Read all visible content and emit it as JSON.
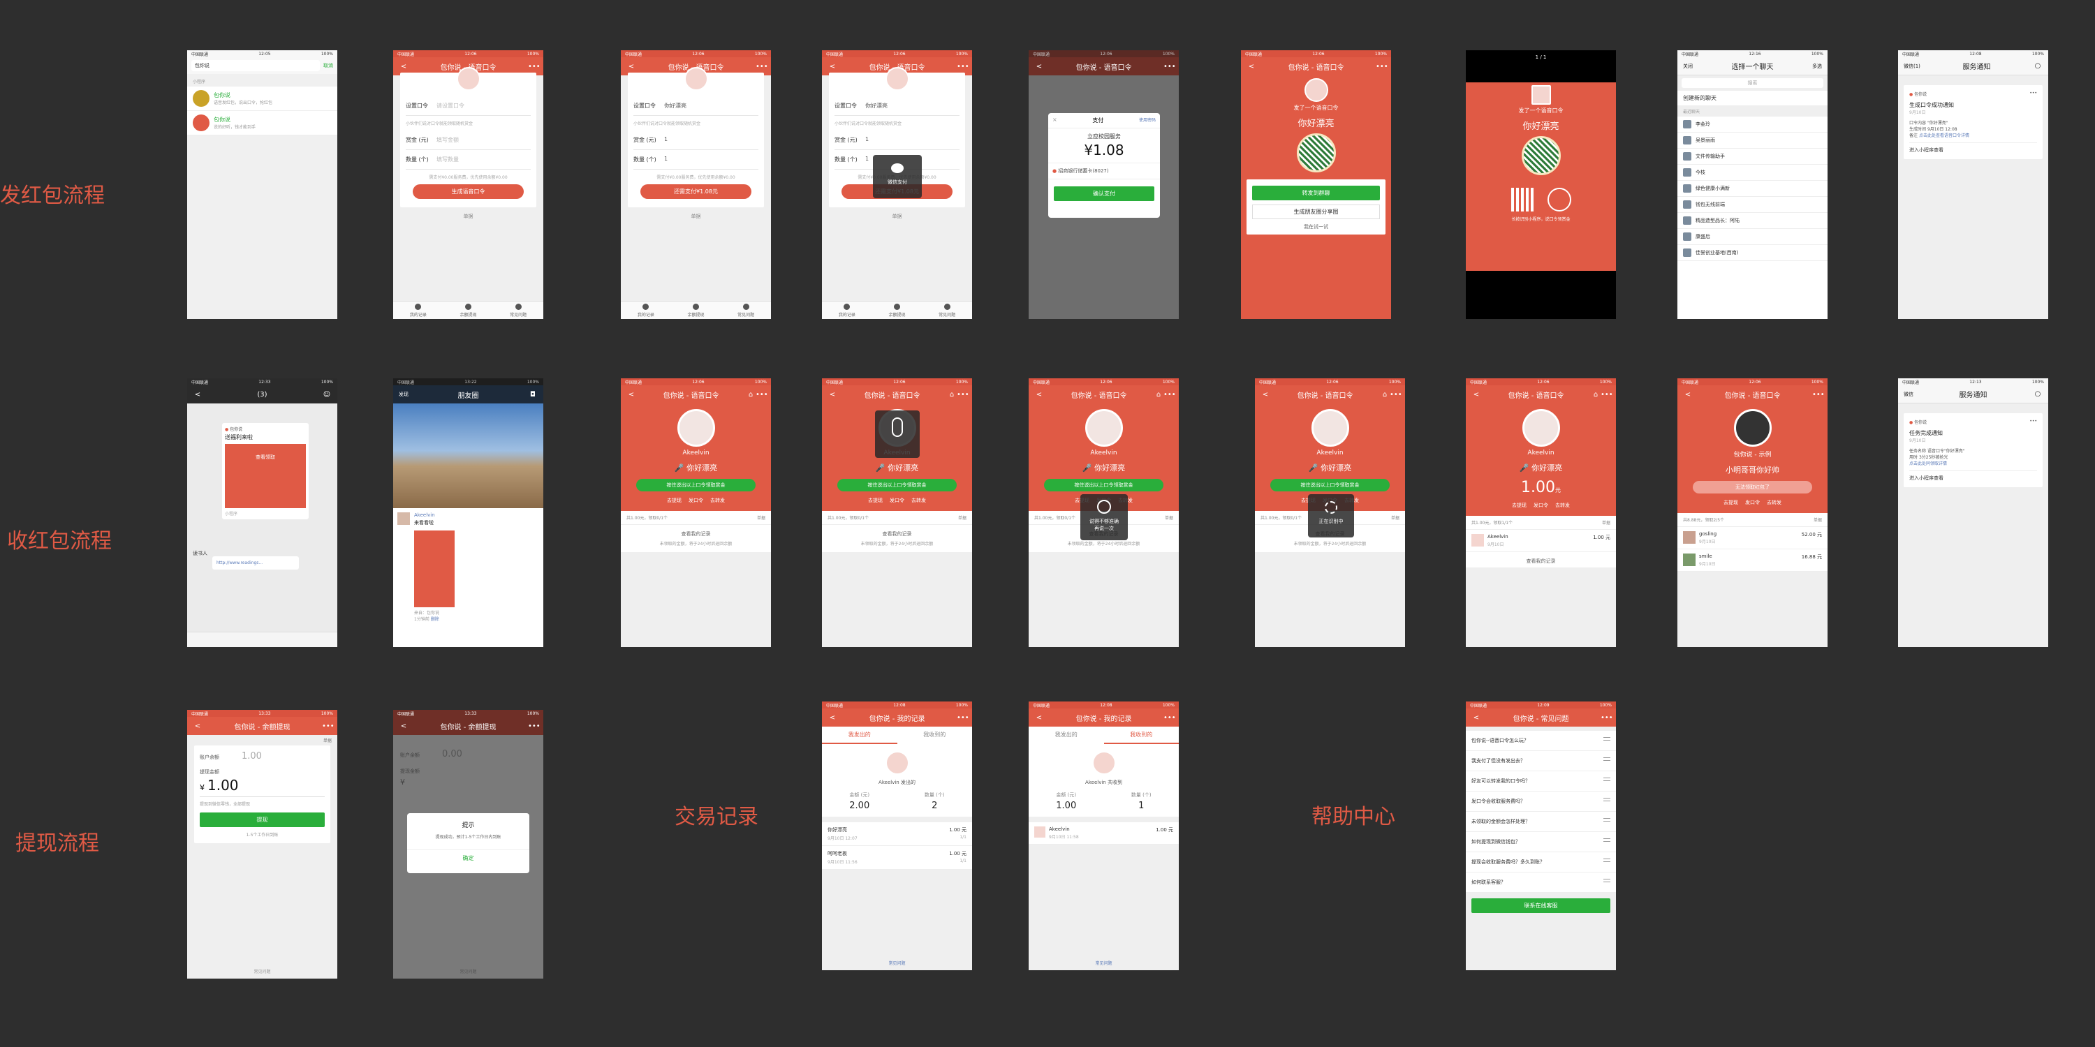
{
  "sections": {
    "send": "发红包流程",
    "receive": "收红包流程",
    "withdraw": "提现流程",
    "records": "交易记录",
    "help": "帮助中心"
  },
  "common": {
    "carrier": "中国联通",
    "battery": "100%",
    "app_title": "包你说 - 语音口令",
    "back": "<",
    "more": "•••",
    "single_list": "单据",
    "tabs": [
      "我的记录",
      "余额提现",
      "常见问题"
    ],
    "nickname": "Akeelvin",
    "voice_word": "你好漂亮",
    "hold_button": "按住说出以上口令领取赏金",
    "actions": [
      "去提现",
      "发口令",
      "去转发"
    ],
    "view_records": "查看我的记录",
    "unclaimed_note": "未领取的金额，将于24小时后退回余额",
    "summary": "共1.00元，领取0/1个",
    "help_link": "常见问题"
  },
  "send": {
    "search": {
      "time": "12:05",
      "query": "包你说",
      "cancel": "取消",
      "section": "小程序",
      "item1_title": "包你说",
      "item1_desc": "语音发红包，说出口令，抢红包",
      "item2_title": "包你说",
      "item2_desc": "说的好听，钱才能到手"
    },
    "form": {
      "time": "12:06",
      "word_label": "设置口令",
      "word_placeholder": "请设置口令",
      "word_value": "你好漂亮",
      "hint": "小伙伴们说对口令就能领取随机赏金",
      "amount_label": "赏金 (元)",
      "amount_placeholder": "填写金额",
      "amount_value": "1",
      "count_label": "数量 (个)",
      "count_placeholder": "填写数量",
      "count_value": "1",
      "fee_note": "需支付¥0.00服务费，优先使用余额¥0.00",
      "gen_button": "生成语音口令",
      "pay_button": "还需支付¥1.08元"
    },
    "wechat_pay_toast": "微信支付",
    "pay": {
      "title": "支付",
      "use_pwd": "使用密码",
      "merchant": "立应校园服务",
      "amount": "¥1.08",
      "bank": "招商银行储蓄卡(8027)",
      "confirm": "确认支付"
    },
    "share": {
      "sent": "发了一个语音口令",
      "word": "你好漂亮",
      "forward": "转发到群聊",
      "moments": "生成朋友圈分享图",
      "later": "我在试一试"
    },
    "poster": {
      "page": "1 / 1",
      "sent": "发了一个语音口令",
      "word": "你好漂亮",
      "scan": "长按识别小程序，说口令领赏金"
    },
    "chat": {
      "time": "12:16",
      "close": "关闭",
      "title": "选择一个聊天",
      "multi": "多选",
      "search": "搜索",
      "new_chat": "创建新的聊天",
      "recent": "最近聊天",
      "contacts": [
        "李金玲",
        "吴景丽雨",
        "文件传输助手",
        "今枝",
        "绿色健康小满新",
        "钱包无线前端",
        "精品造型品长：阿陆",
        "康盛后",
        "佳誉创业基地(西南)"
      ]
    },
    "notice": {
      "time": "12:08",
      "back": "微信(1)",
      "title": "服务通知",
      "app": "包你说",
      "notice_title": "生成口令成功通知",
      "date": "9月10日",
      "k1": "口令内容",
      "v1": "\"你好漂亮\"",
      "k2": "生成时间",
      "v2": "9月10日 12:08",
      "k3": "备注",
      "v3": "点击此处查看语音口令详情",
      "enter": "进入小程序查看"
    }
  },
  "receive": {
    "group": {
      "time": "12:33",
      "title": "(3)",
      "card_app": "包你说",
      "card_title": "送福利来啦",
      "card_btn": "查看领取",
      "card_foot": "小程序",
      "sender": "读书人",
      "link": "http://www.readings..."
    },
    "moments": {
      "time": "13:22",
      "back": "发现",
      "title": "朋友圈",
      "name": "Akeelvin",
      "post": "来看看啦",
      "source": "来自：包你说",
      "ago": "1分钟前",
      "del": "删除"
    },
    "recording_toast": "",
    "fail_toast": "再说一次",
    "fail_sub": "说得不够准确",
    "loading_toast": "正在识别中",
    "received": {
      "amount": "1.00",
      "unit": "元",
      "summary": "共1.00元，领取1/1个",
      "winner": "Akeelvin",
      "winner_amount": "1.00 元",
      "winner_time": "9月10日"
    },
    "other": {
      "nickname": "包你说 - 示例",
      "word": "小明哥哥你好帅",
      "disabled_btn": "无法领取红包了",
      "summary": "共8.88元，领取2/5个",
      "u1": "gosling",
      "u1_amount": "52.00 元",
      "u1_time": "9月10日",
      "u2": "smile",
      "u2_amount": "16.88 元",
      "u2_time": "9月10日"
    },
    "notice": {
      "time": "12:13",
      "back": "微信",
      "title": "服务通知",
      "app": "包你说",
      "notice_title": "任务完成通知",
      "date": "9月10日",
      "k1": "任务名称",
      "v1": "语音口令\"你好漂亮\"",
      "k2": "用时",
      "v2": "3分25秒被抢光",
      "k3": "",
      "v3": "点击此处同领取详情",
      "enter": "进入小程序查看"
    }
  },
  "withdraw": {
    "title": "包你说 - 余额提现",
    "time": "13:33",
    "balance_label": "账户余额",
    "balance": "1.00",
    "amount_label": "提现金额",
    "currency": "¥",
    "amount": "1.00",
    "hint": "提现到微信零钱，全部提现",
    "button": "提现",
    "arrival": "1-5个工作日到账",
    "balance_after": "0.00",
    "dialog_title": "提示",
    "dialog_text": "提现成功，预计1-5个工作日内到账",
    "dialog_ok": "确定"
  },
  "records": {
    "title": "包你说 - 我的记录",
    "time": "12:08",
    "tab_sent": "我发出的",
    "tab_recv": "我收到的",
    "sent_label": "Akeelvin 发出的",
    "recv_label": "Akeelvin 共收到",
    "amount_label": "金额 (元)",
    "count_label": "数量 (个)",
    "sent_amount": "2.00",
    "sent_count": "2",
    "recv_amount": "1.00",
    "recv_count": "1",
    "sent_items": [
      {
        "name": "你好漂亮",
        "amount": "1.00 元",
        "date": "9月10日 12:07",
        "ratio": "1/1"
      },
      {
        "name": "呵呵老板",
        "amount": "1.00 元",
        "date": "9月10日 11:56",
        "ratio": "1/1"
      }
    ],
    "recv_items": [
      {
        "name": "Akeelvin",
        "amount": "1.00 元",
        "date": "9月10日 11:58"
      }
    ]
  },
  "help": {
    "title": "包你说 - 常见问题",
    "time": "12:09",
    "questions": [
      "包你说--语音口令怎么玩？",
      "我支付了但没有发出去？",
      "好友可以转发我的口令吗？",
      "发口令会收取服务费吗？",
      "未领取的金额会怎样处理？",
      "如何提现到微信钱包？",
      "提现会收取服务费吗？多久到账？",
      "如何联系客服？"
    ],
    "contact_button": "联系在线客服"
  },
  "colors": {
    "bg": "#2e2e2e",
    "brand_red": "#e05a45",
    "wechat_green": "#2aae3b"
  }
}
